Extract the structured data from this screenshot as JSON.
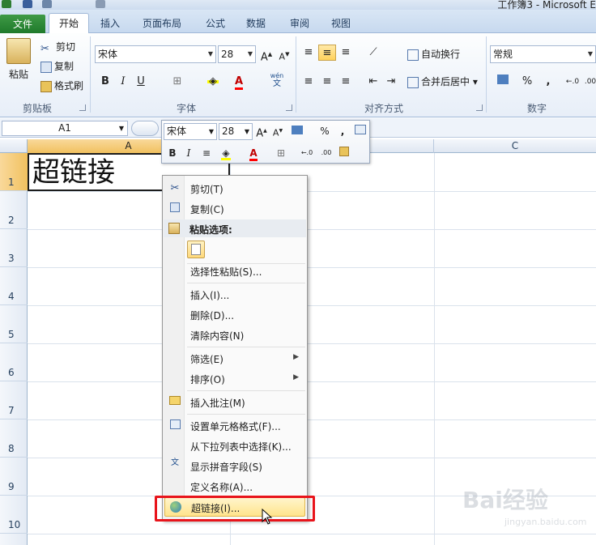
{
  "window": {
    "title": "工作簿3 - Microsoft E"
  },
  "ribbon": {
    "tabs": [
      "文件",
      "开始",
      "插入",
      "页面布局",
      "公式",
      "数据",
      "审阅",
      "视图"
    ],
    "clipboard": {
      "paste": "粘贴",
      "cut": "剪切",
      "copy": "复制",
      "format_painter": "格式刷",
      "group": "剪贴板"
    },
    "font": {
      "name": "宋体",
      "size": "28",
      "group": "字体",
      "phonetic": "wén"
    },
    "alignment": {
      "wrap": "自动换行",
      "merge": "合并后居中",
      "group": "对齐方式"
    },
    "number": {
      "format": "常规",
      "percent": "%",
      "comma": ",",
      "group": "数字"
    }
  },
  "formula_bar": {
    "name_box": "A1"
  },
  "grid": {
    "columns": [
      "A",
      "C"
    ],
    "rows": [
      "1",
      "2",
      "3",
      "4",
      "5",
      "6",
      "7",
      "8",
      "9",
      "10"
    ],
    "cell_a1": "超链接"
  },
  "mini_toolbar": {
    "font": "宋体",
    "size": "28",
    "percent": "%",
    "comma": ","
  },
  "context_menu": {
    "cut": "剪切(T)",
    "copy": "复制(C)",
    "paste_options": "粘贴选项:",
    "paste_special": "选择性粘贴(S)...",
    "insert": "插入(I)...",
    "delete": "删除(D)...",
    "clear": "清除内容(N)",
    "filter": "筛选(E)",
    "sort": "排序(O)",
    "insert_comment": "插入批注(M)",
    "format_cells": "设置单元格格式(F)...",
    "pick_from_list": "从下拉列表中选择(K)...",
    "show_phonetic": "显示拼音字段(S)",
    "define_name": "定义名称(A)...",
    "hyperlink": "超链接(I)..."
  },
  "watermark": {
    "brand": "Bai经验",
    "url": "jingyan.baidu.com"
  },
  "colors": {
    "file_tab": "#1f7a2b",
    "highlight": "#ffe48c",
    "red_box": "#e8141b"
  }
}
